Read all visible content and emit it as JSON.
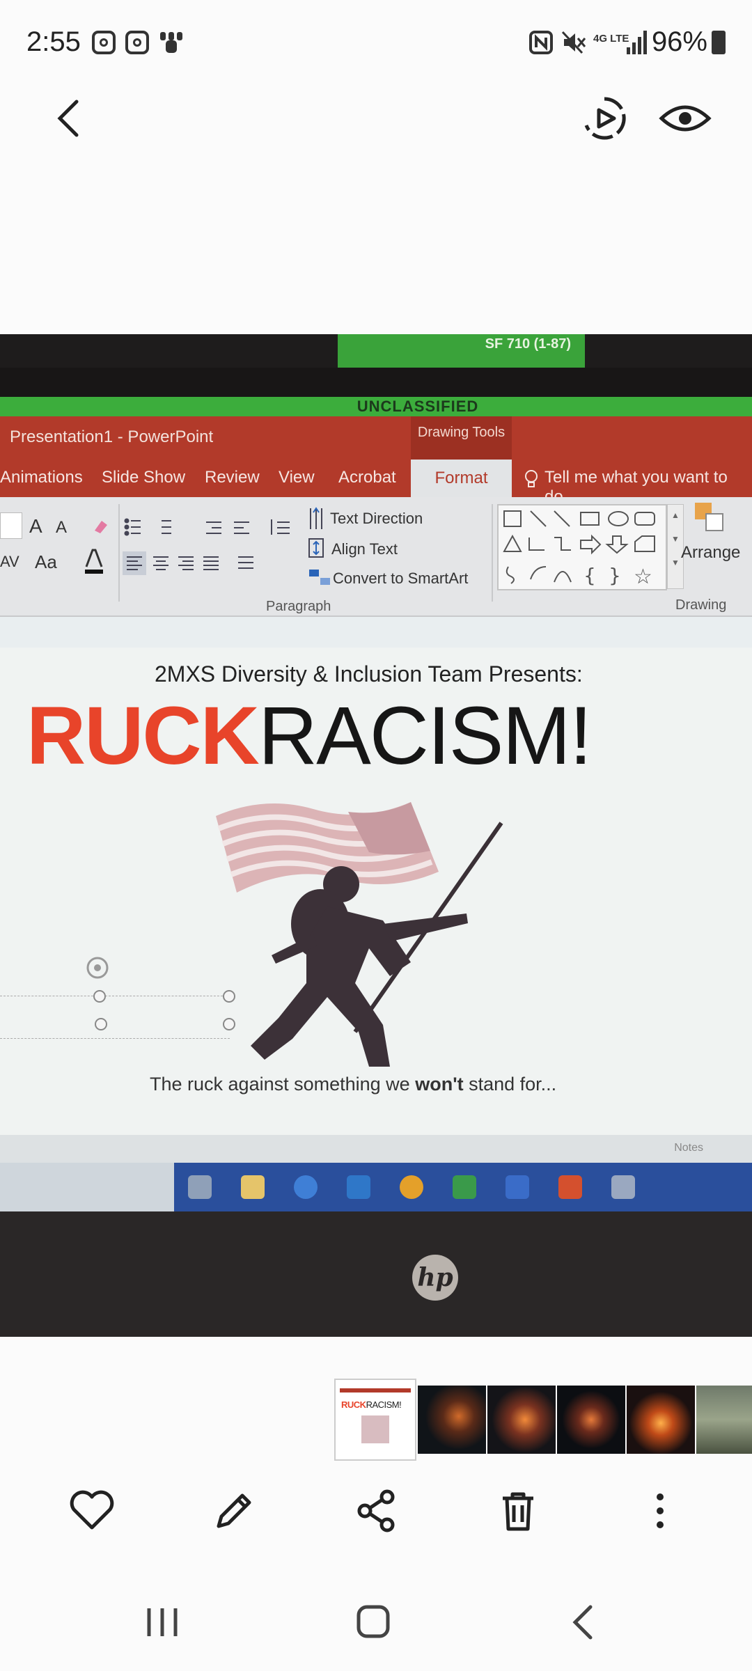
{
  "status_bar": {
    "time": "2:55",
    "network": "4G LTE",
    "battery": "96%"
  },
  "top_bar": {
    "back_icon": "chevron-left-icon",
    "motion_icon": "motion-photo-play-icon",
    "view_icon": "eye-icon"
  },
  "photo": {
    "label_strip": "SF 710 (1-87)",
    "classification": "UNCLASSIFIED",
    "app_title": "Presentation1 - PowerPoint",
    "context_tab": "Drawing Tools",
    "tabs": [
      "Animations",
      "Slide Show",
      "Review",
      "View",
      "Acrobat"
    ],
    "active_tab": "Format",
    "tell_me": "Tell me what you want to do...",
    "ribbon": {
      "text_direction": "Text Direction",
      "align_text": "Align Text",
      "convert_smartart": "Convert to SmartArt",
      "paragraph_label": "Paragraph",
      "arrange": "Arrange",
      "drawing_label": "Drawing",
      "font_grow": "A",
      "font_shrink": "A",
      "case_label": "Aa",
      "spacing_label": "AV"
    },
    "slide": {
      "subtitle": "2MXS Diversity & Inclusion Team Presents:",
      "title_red": "RUCK",
      "title_black": "RACISM!",
      "tagline_pre": "The ruck against something we ",
      "tagline_bold": "won't",
      "tagline_post": " stand for..."
    },
    "status_notes": "Notes",
    "laptop_brand": "hp"
  },
  "action_bar": {
    "favorite_icon": "heart-icon",
    "edit_icon": "pencil-icon",
    "share_icon": "share-icon",
    "delete_icon": "trash-icon",
    "more_icon": "more-vertical-icon"
  },
  "thumb_mini": {
    "title_red": "RUCK",
    "title_black": "RACISM!"
  },
  "colors": {
    "ribbon_red": "#b23a2a",
    "title_red": "#e8442a",
    "classification_green": "#3cad3c",
    "taskbar_blue": "#2a4f9c"
  }
}
